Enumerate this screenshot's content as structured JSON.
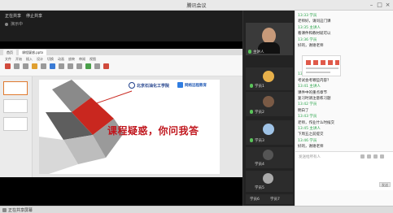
{
  "window": {
    "title": "腾讯会议"
  },
  "share": {
    "menu": [
      "正在共享",
      "停止共享"
    ],
    "sub_label": "演示中"
  },
  "wps": {
    "tabs": [
      "首页",
      "课程疑惑.pptx"
    ],
    "ribbon_menu": [
      "文件",
      "开始",
      "插入",
      "设计",
      "切换",
      "动画",
      "放映",
      "审阅",
      "视图"
    ]
  },
  "slide": {
    "title": "课程疑惑，你问我答",
    "logo_university": "北京石油化工学院",
    "logo_network": "网络远程教育"
  },
  "videos": [
    {
      "name": "主讲人"
    },
    {
      "name": "学员1"
    },
    {
      "name": "学员2"
    },
    {
      "name": "学员3"
    },
    {
      "name": "学员4"
    },
    {
      "name": "学员5"
    },
    {
      "name": "学员6"
    },
    {
      "name": "学员7"
    }
  ],
  "chat": {
    "messages": [
      {
        "type": "meta",
        "text": "13:33 学员"
      },
      {
        "type": "msg",
        "text": "老师好，请问这门课"
      },
      {
        "type": "meta",
        "text": "13:35 主讲人"
      },
      {
        "type": "msg",
        "text": "看课件和教材就可以"
      },
      {
        "type": "meta",
        "text": "13:36 学员"
      },
      {
        "type": "msg",
        "text": "好的，谢谢老师"
      },
      {
        "type": "meta",
        "text": "13:40 学员"
      },
      {
        "type": "msg",
        "text": "考试会考哪些内容？"
      },
      {
        "type": "meta",
        "text": "13:41 主讲人"
      },
      {
        "type": "msg",
        "text": "课件中的重点章节"
      },
      {
        "type": "msg",
        "text": "复习时请注意练习题"
      },
      {
        "type": "meta",
        "text": "13:42 学员"
      },
      {
        "type": "msg",
        "text": "明白了"
      },
      {
        "type": "meta",
        "text": "13:43 学员"
      },
      {
        "type": "msg",
        "text": "老师，作业什么时候交"
      },
      {
        "type": "meta",
        "text": "13:45 主讲人"
      },
      {
        "type": "msg",
        "text": "下周五之前提交"
      },
      {
        "type": "meta",
        "text": "13:46 学员"
      },
      {
        "type": "msg",
        "text": "好的，谢谢老师"
      }
    ],
    "input_placeholder": "发送给所有人",
    "send_label": "发送"
  },
  "status": {
    "text": "正在共享屏幕"
  }
}
